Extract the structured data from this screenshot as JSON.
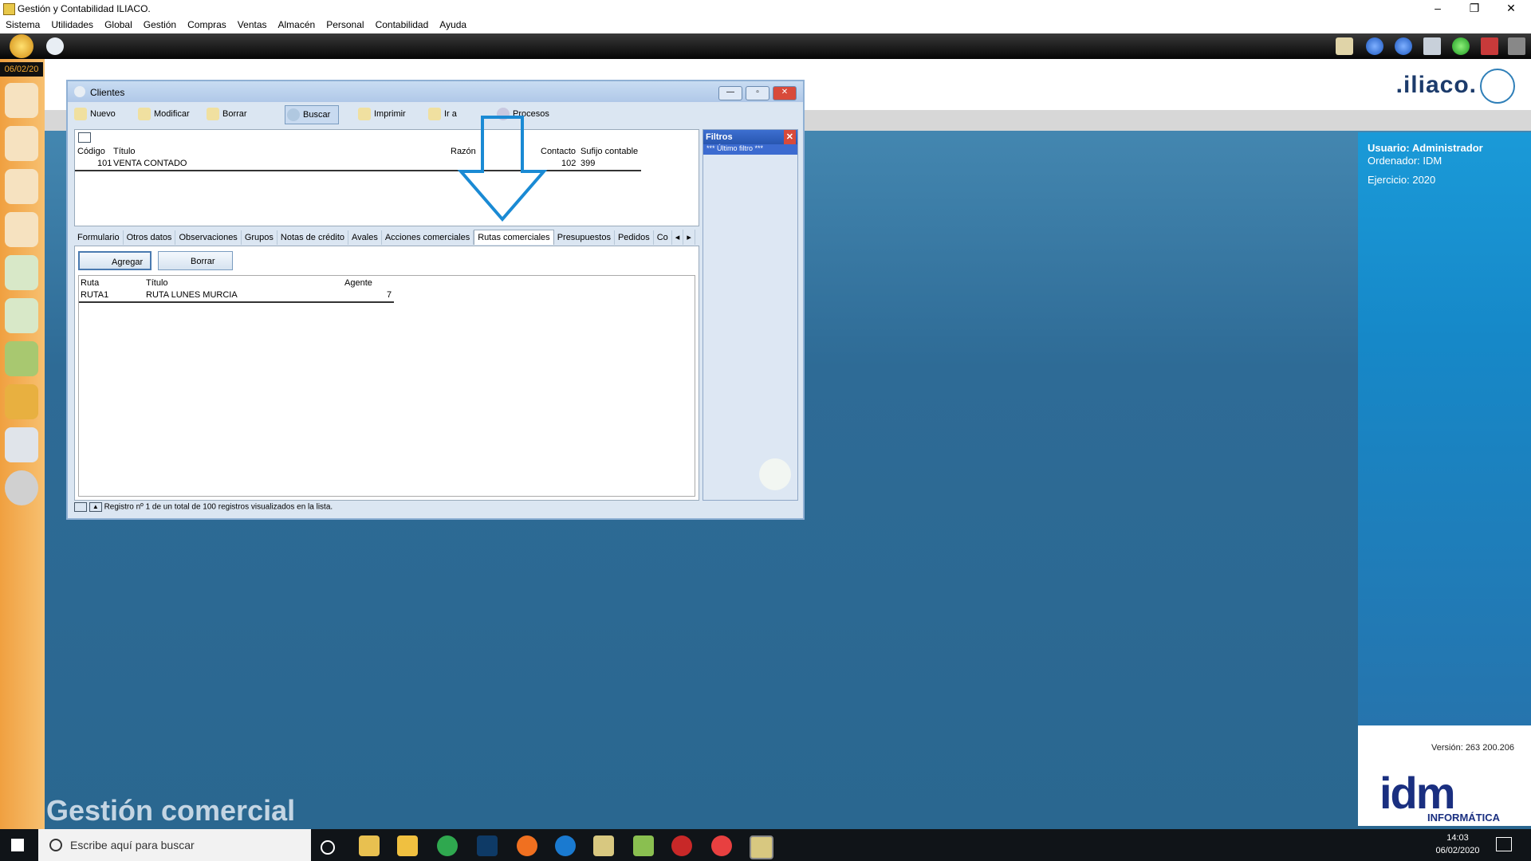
{
  "app": {
    "title": "Gestión y Contabilidad ILIACO.",
    "menu": [
      "Sistema",
      "Utilidades",
      "Global",
      "Gestión",
      "Compras",
      "Ventas",
      "Almacén",
      "Personal",
      "Contabilidad",
      "Ayuda"
    ],
    "date": "06/02/20",
    "logo_text": ".iliaco.",
    "desktop_caption": "Gestión comercial"
  },
  "info": {
    "usuario": "Usuario: Administrador",
    "ordenador": "Ordenador: IDM",
    "ejercicio": "Ejercicio: 2020",
    "version": "Versión: 263 200.206",
    "brand": "idm",
    "brand_sub": "INFORMÁTICA"
  },
  "clientes": {
    "title": "Clientes",
    "toolbar": [
      "Nuevo",
      "Modificar",
      "Borrar",
      "Buscar",
      "Imprimir",
      "Ir a",
      "Procesos"
    ],
    "columns": [
      "Código",
      "Título",
      "Razón",
      "Contacto",
      "Sufijo contable"
    ],
    "row": {
      "codigo": "101",
      "titulo": "VENTA CONTADO",
      "contacto": "102",
      "sufijo": "399"
    },
    "filtros_title": "Filtros",
    "filtros_item": "*** Último filtro ***",
    "tabs": [
      "Formulario",
      "Otros datos",
      "Observaciones",
      "Grupos",
      "Notas de crédito",
      "Avales",
      "Acciones comerciales",
      "Rutas comerciales",
      "Presupuestos",
      "Pedidos",
      "Co"
    ],
    "active_tab": "Rutas comerciales",
    "sub_buttons": {
      "agregar": "Agregar",
      "borrar": "Borrar"
    },
    "rutas_columns": [
      "Ruta",
      "Título",
      "Agente"
    ],
    "rutas_row": {
      "ruta": "RUTA1",
      "titulo": "RUTA LUNES MURCIA",
      "agente": "7"
    },
    "status": "Registro nº 1 de un total de 100 registros visualizados en la lista."
  },
  "taskbar": {
    "search_placeholder": "Escribe aquí para buscar",
    "time": "14:03",
    "date": "06/02/2020"
  }
}
